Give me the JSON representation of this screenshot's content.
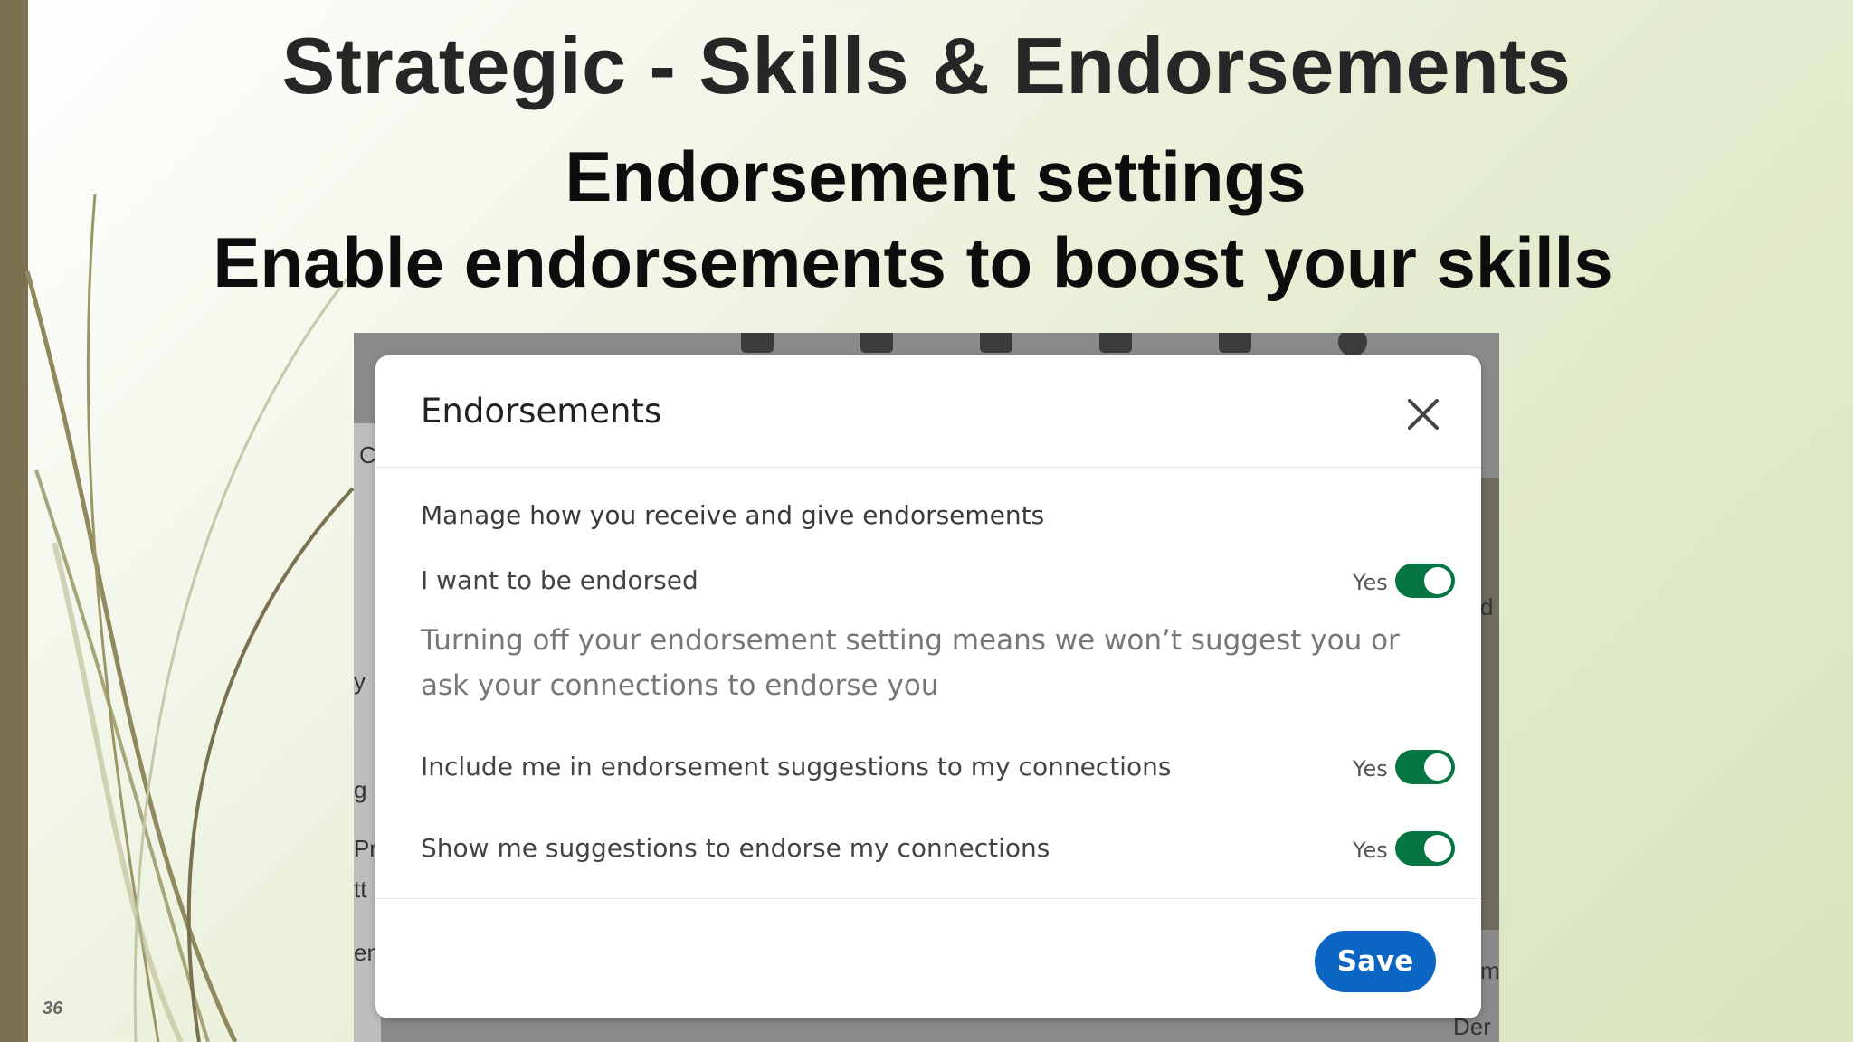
{
  "slide": {
    "title": "Strategic - Skills & Endorsements",
    "subtitle_line1": "Endorsement settings",
    "subtitle_line2": "Enable endorsements to boost your skills",
    "number": "36"
  },
  "modal": {
    "title": "Endorsements",
    "intro": "Manage how you receive and give endorsements",
    "settings": [
      {
        "label": "I want to be endorsed",
        "state": "Yes",
        "enabled": true
      },
      {
        "label": "Include me in endorsement suggestions to my connections",
        "state": "Yes",
        "enabled": true
      },
      {
        "label": "Show me suggestions to endorse my connections",
        "state": "Yes",
        "enabled": true
      }
    ],
    "help_text": "Turning off your endorsement setting means we won’t suggest you or ask your connections to endorse you",
    "save_label": "Save"
  },
  "background_fragments": {
    "f1": "C",
    "f2": "y",
    "f3": "g",
    "f4": "Pr",
    "f5": "tt",
    "f6": "en",
    "f7": "Der",
    "f8": "m",
    "f9": "d"
  },
  "colors": {
    "toggle_on": "#057642",
    "save_button": "#0a66c2",
    "slide_bar": "#7a7150"
  },
  "icons": {
    "close": "close-icon"
  }
}
